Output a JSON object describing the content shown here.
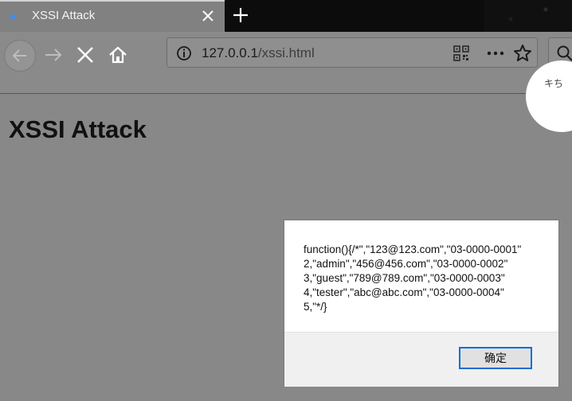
{
  "browser": {
    "tab": {
      "title": "XSSI Attack"
    },
    "address": {
      "host": "127.0.0.1",
      "path": "/xssi.html"
    },
    "sticker_text": "キち"
  },
  "page": {
    "heading": "XSSI Attack"
  },
  "dialog": {
    "message": "function(){/*\",\"123@123.com\",\"03-0000-0001\"\n2,\"admin\",\"456@456.com\",\"03-0000-0002\"\n3,\"guest\",\"789@789.com\",\"03-0000-0003\"\n4,\"tester\",\"abc@abc.com\",\"03-0000-0004\"\n5,\"*/}",
    "ok_label": "确定"
  },
  "icons": [
    "tab-favicon-icon",
    "close-tab-icon",
    "new-tab-icon",
    "back-icon",
    "forward-icon",
    "stop-icon",
    "home-icon",
    "site-info-icon",
    "qr-code-icon",
    "more-actions-icon",
    "bookmark-star-icon",
    "search-icon"
  ]
}
